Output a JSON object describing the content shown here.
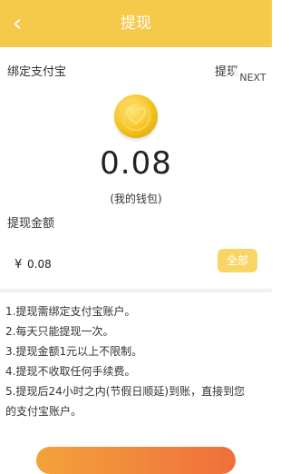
{
  "header": {
    "title": "提现",
    "back_icon": "chevron-left-icon"
  },
  "bind": {
    "label": "绑定支付宝",
    "right_label": "提现",
    "next_label": "NEXT"
  },
  "wallet": {
    "coin_icon": "heart-coin-icon",
    "balance": "0.08",
    "caption": "(我的钱包)"
  },
  "withdraw": {
    "label": "提现金额",
    "currency": "¥",
    "amount_value": "0.08",
    "all_label": "全部"
  },
  "rules": [
    "1.提现需绑定支付宝账户。",
    "2.每天只能提现一次。",
    "3.提现金额1元以上不限制。",
    "4.提现不收取任何手续费。",
    "5.提现后24小时之内(节假日顺延)到账，直接到您",
    "的支付宝账户。"
  ],
  "colors": {
    "header": "#f5c94a",
    "coin": "#f4c21c",
    "all_button": "#f8d565",
    "submit_button": "#ef6f3c"
  }
}
